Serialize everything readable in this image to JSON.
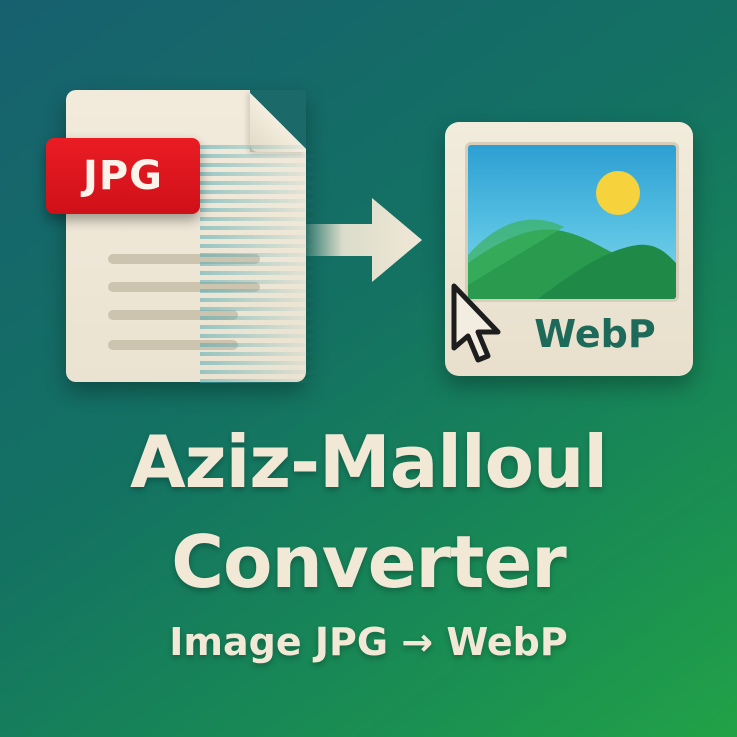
{
  "badge": {
    "format_from": "JPG"
  },
  "target": {
    "format_to": "WebP"
  },
  "title": {
    "line1": "Aziz-Malloul",
    "line2": "Converter"
  },
  "subtitle": "Image JPG → WebP",
  "colors": {
    "background_start": "#17606f",
    "background_end": "#22a247",
    "jpg_badge": "#e31c24",
    "cream": "#f1e8d6",
    "webp_text": "#1e6a5a",
    "sun": "#f6d33c",
    "hills": "#2a9a4e"
  },
  "icons": [
    "document-icon",
    "arrow-right-icon",
    "image-icon",
    "mouse-pointer-icon"
  ]
}
